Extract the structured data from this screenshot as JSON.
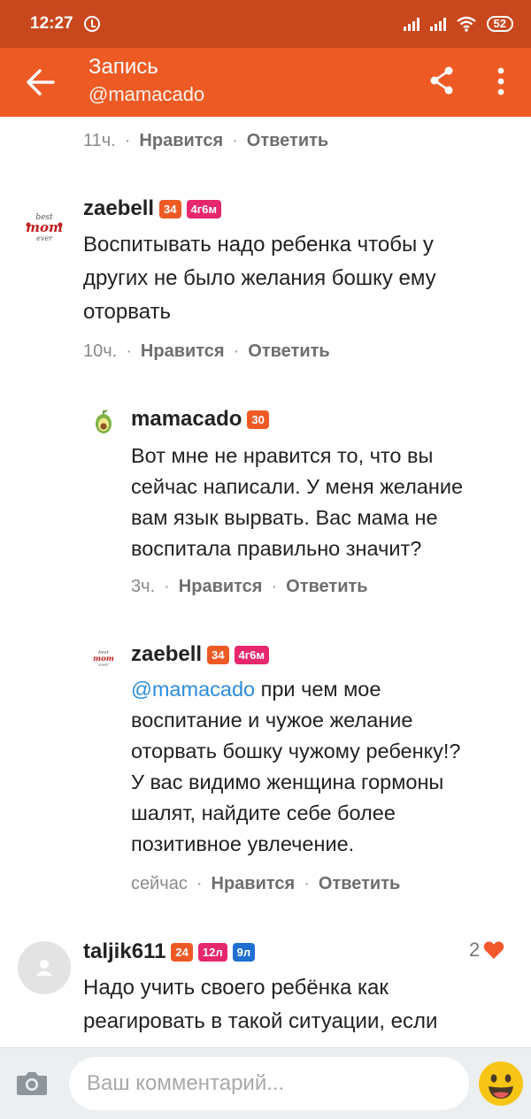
{
  "status_bar": {
    "time": "12:27",
    "battery": "52"
  },
  "header": {
    "title": "Запись",
    "subtitle": "@mamacado"
  },
  "actions": {
    "like": "Нравится",
    "reply": "Ответить"
  },
  "comments": [
    {
      "time": "11ч."
    },
    {
      "author": "zaebell",
      "badges": [
        "34",
        "4г6м"
      ],
      "lines": [
        "Воспитывать надо ребенка чтобы у",
        "других не было желания бошку ему",
        "оторвать"
      ],
      "time": "10ч."
    },
    {
      "author": "mamacado",
      "badges": [
        "30"
      ],
      "lines": [
        "Вот мне не нравится то, что вы",
        "сейчас написали. У меня желание",
        "вам язык вырвать. Вас мама не",
        "воспитала правильно значит?"
      ],
      "time": "3ч."
    },
    {
      "author": "zaebell",
      "badges": [
        "34",
        "4г6м"
      ],
      "mention": "@mamacado",
      "lines": [
        "при чем мое",
        "воспитание и чужое желание",
        "оторвать бошку чужому ребенку!?",
        "У вас видимо женщина гормоны",
        "шалят, найдите себе более",
        "позитивное увлечение."
      ],
      "time": "сейчас"
    },
    {
      "author": "taljik611",
      "badges": [
        "24",
        "12л",
        "9л"
      ],
      "likes": "2",
      "lines": [
        "Надо учить своего ребёнка как",
        "реагировать в такой ситуации, если"
      ]
    }
  ],
  "avatar_logo": {
    "top": "best",
    "middle": "mom",
    "bottom": "ever"
  },
  "composer": {
    "placeholder": "Ваш комментарий..."
  },
  "colors": {
    "status_bar": "#c9471d",
    "app_bar": "#ee5a24",
    "badge_pink": "#e7276d",
    "badge_blue": "#1f6fd1",
    "mention": "#2b8be0"
  },
  "icons": [
    "back-arrow-icon",
    "share-icon",
    "more-vert-icon",
    "camera-icon",
    "emoji-icon",
    "heart-icon",
    "alarm-icon",
    "signal-icon",
    "wifi-icon",
    "avatar-placeholder-icon"
  ]
}
